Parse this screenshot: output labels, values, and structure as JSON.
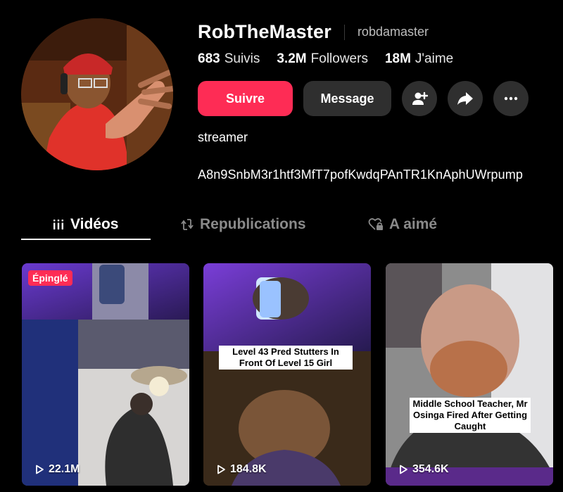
{
  "profile": {
    "display_name": "RobTheMaster",
    "username": "robdamaster",
    "bio": "streamer",
    "link": "A8n9SnbM3r1htf3MfT7pofKwdqPAnTR1KnAphUWrpump"
  },
  "stats": {
    "following_count": "683",
    "following_label": "Suivis",
    "followers_count": "3.2M",
    "followers_label": "Followers",
    "likes_count": "18M",
    "likes_label": "J'aime"
  },
  "actions": {
    "follow_label": "Suivre",
    "message_label": "Message",
    "add_friend_icon": "add-user-icon",
    "share_icon": "share-arrow-icon",
    "more_icon": "more-dots-icon"
  },
  "tabs": [
    {
      "label": "Vidéos",
      "icon": "grid-bars-icon",
      "active": true
    },
    {
      "label": "Republications",
      "icon": "repost-icon",
      "active": false
    },
    {
      "label": "A aimé",
      "icon": "heart-lock-icon",
      "active": false
    }
  ],
  "videos": [
    {
      "pinned_label": "Épinglé",
      "caption": "",
      "views": "22.1M"
    },
    {
      "pinned_label": "",
      "caption": "Level 43 Pred Stutters In Front Of Level 15 Girl",
      "views": "184.8K"
    },
    {
      "pinned_label": "",
      "caption": "Middle School Teacher, Mr Osinga Fired After Getting Caught",
      "views": "354.6K"
    }
  ],
  "colors": {
    "accent": "#fe2c55",
    "background": "#000000",
    "button_secondary": "#2f2f2f"
  }
}
